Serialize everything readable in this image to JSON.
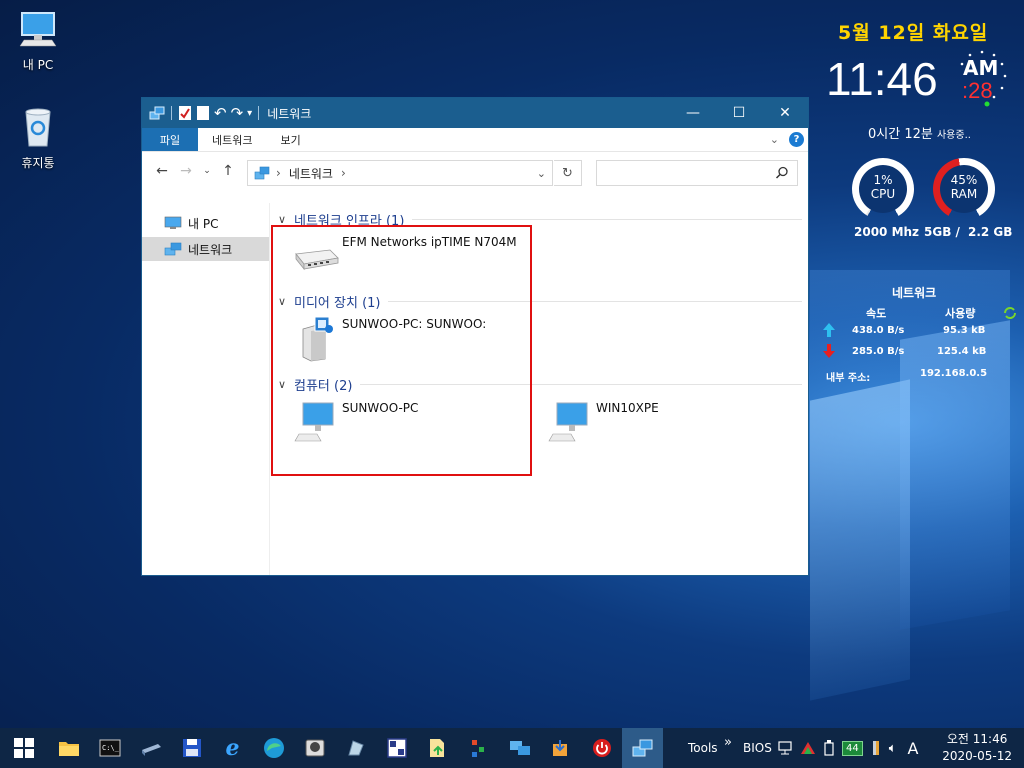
{
  "desktop": {
    "icons": [
      {
        "label": "내 PC"
      },
      {
        "label": "휴지통"
      }
    ]
  },
  "widget": {
    "date": "5월 12일 화요일",
    "time": "11:46",
    "ampm": "AM",
    "seconds": ":28",
    "uptime": "0시간 12분",
    "uptime_suffix": "사용중..",
    "cpu": {
      "percent": "1%",
      "label": "CPU",
      "level": 0.01,
      "info": "2000 Mhz"
    },
    "ram": {
      "percent": "45%",
      "label": "RAM",
      "level": 0.45,
      "info_total": "5GB /",
      "info_free": "2.2 GB"
    },
    "network": {
      "title": "네트워크",
      "speed_header": "속도",
      "usage_header": "사용량",
      "up_speed": "438.0 B/s",
      "up_usage": "95.3 kB",
      "down_speed": "285.0 B/s",
      "down_usage": "125.4 kB",
      "ip_label": "내부 주소:",
      "ip": "192.168.0.5"
    }
  },
  "explorer": {
    "title": "네트워크",
    "ribbon_tabs": [
      "파일",
      "네트워크",
      "보기"
    ],
    "help": "?",
    "address": {
      "location": "네트워크"
    },
    "search_placeholder": "",
    "nav_pane": [
      {
        "label": "내 PC",
        "selected": false
      },
      {
        "label": "네트워크",
        "selected": true
      }
    ],
    "groups": [
      {
        "label": "네트워크 인프라 (1)",
        "items": [
          {
            "name": "EFM Networks ipTIME N704M",
            "icon": "router-icon"
          }
        ]
      },
      {
        "label": "미디어 장치 (1)",
        "items": [
          {
            "name": "SUNWOO-PC: SUNWOO:",
            "icon": "media-server-icon"
          }
        ]
      },
      {
        "label": "컴퓨터 (2)",
        "items": [
          {
            "name": "SUNWOO-PC",
            "icon": "computer-icon"
          },
          {
            "name": "WIN10XPE",
            "icon": "computer-icon"
          }
        ]
      }
    ]
  },
  "taskbar": {
    "tools_label": "Tools",
    "more": "»",
    "bios_label": "BIOS",
    "battery_badge": "44",
    "ime": "A",
    "clock_time": "오전 11:46",
    "clock_date": "2020-05-12"
  },
  "colors": {
    "titlebar": "#1b5e8f",
    "file_tab": "#1c6fb3",
    "highlight_box": "#e01010",
    "date_yellow": "#ffd400",
    "seconds_red": "#ff3030",
    "ram_red": "#e02020"
  }
}
